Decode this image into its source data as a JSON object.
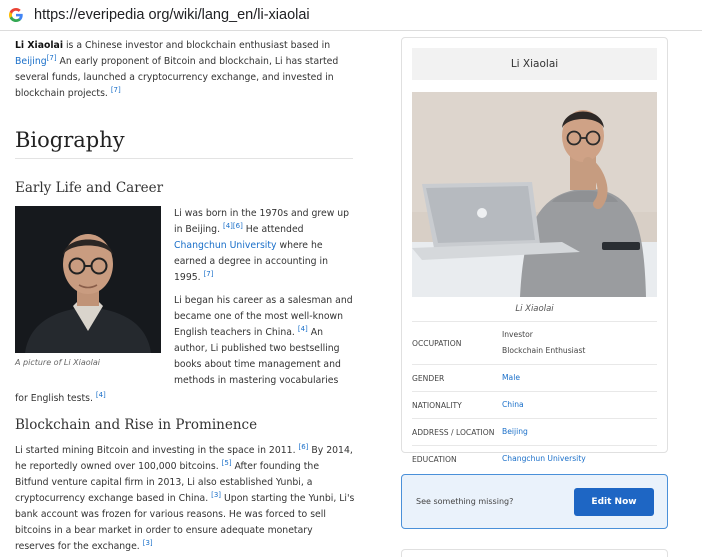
{
  "browser": {
    "url": "https://everipedia org/wiki/lang_en/li-xiaolai"
  },
  "article": {
    "intro": {
      "name": "Li Xiaolai",
      "t1": " is a Chinese investor and blockchain enthusiast based in ",
      "beijing": "Beijing",
      "ref1": "[7]",
      "t2": " An early proponent of Bitcoin and blockchain, Li has started several funds, launched a cryptocurrency exchange, and invested in blockchain projects. ",
      "ref2": "[7]"
    },
    "biography_heading": "Biography",
    "early": {
      "heading": "Early Life and Career",
      "image_caption": "A picture of Li Xiaolai",
      "p1_t1": "Li was born in the 1970s and grew up in Beijing. ",
      "p1_ref1": "[4]",
      "p1_ref2": "[6]",
      "p1_t2": " He attended ",
      "p1_link": "Changchun University",
      "p1_t3": " where he earned a degree in accounting in 1995. ",
      "p1_ref3": "[7]",
      "p2_t1": "Li began his career as a salesman and became one of the most well-known English teachers in China. ",
      "p2_ref1": "[4]",
      "p2_t2": " An author, Li published two bestselling books about time management and methods in mastering vocabularies",
      "p2_tail": "for English tests. ",
      "p2_ref2": "[4]"
    },
    "chain": {
      "heading": "Blockchain and Rise in Prominence",
      "t1": "Li started mining Bitcoin and investing in the space in 2011. ",
      "ref1": "[6]",
      "t2": " By 2014, he reportedly owned over 100,000 bitcoins. ",
      "ref2": "[5]",
      "t3": " After founding the Bitfund venture capital firm in 2013, Li also established Yunbi, a cryptocurrency exchange based in China. ",
      "ref3": "[3]",
      "t4": " Upon starting the Yunbi, Li's bank account was frozen for various reasons.  He was forced to sell bitcoins in a bear market in order to ensure adequate monetary reserves for the exchange. ",
      "ref4": "[3]"
    }
  },
  "infobox": {
    "title": "Li Xiaolai",
    "caption": "Li Xiaolai",
    "occupation_label": "OCCUPATION",
    "occupation_1": "Investor",
    "occupation_2": "Blockchain Enthusiast",
    "gender_label": "GENDER",
    "gender": "Male",
    "nationality_label": "NATIONALITY",
    "nationality": "China",
    "address_label": "ADDRESS / LOCATION",
    "address": "Beijing",
    "education_label": "EDUCATION",
    "education": "Changchun University"
  },
  "edit_prompt": {
    "question": "See something missing?",
    "button": "Edit Now"
  },
  "colors": {
    "link": "#1a6fc9",
    "button": "#1e66c4",
    "prompt_bg": "#eaf2fb"
  }
}
